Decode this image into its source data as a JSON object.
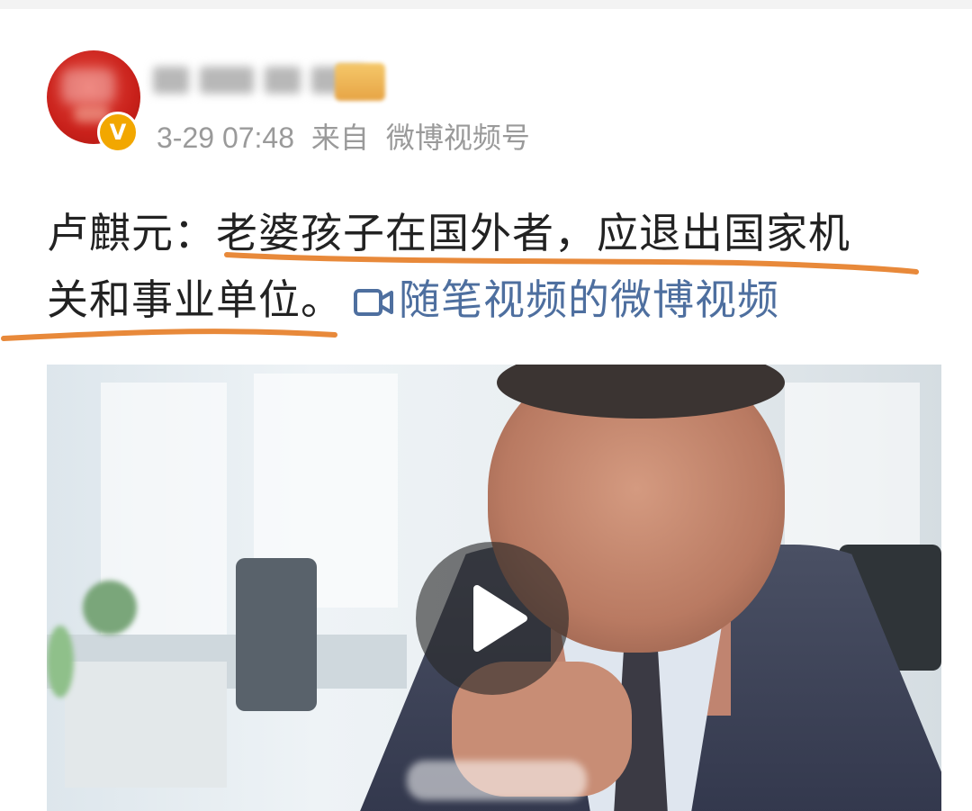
{
  "post": {
    "author": {
      "avatar_color": "#c9211b",
      "verified_badge_icon": "verified-v-icon",
      "badge_text": "V"
    },
    "meta": {
      "date": "3-29",
      "time": "07:48",
      "from_label": "来自",
      "source": "微博视频号"
    },
    "text": {
      "speaker": "卢麒元：",
      "line1_rest": "老婆孩子在国外者，应退出国家机",
      "line2": "关和事业单位。",
      "video_link_icon": "video-camera-icon",
      "video_link": "随笔视频的微博视频"
    },
    "annotations": {
      "underline_color": "#e8893a"
    },
    "video": {
      "play_icon": "play-icon"
    }
  },
  "colors": {
    "link": "#4e6f9f",
    "meta": "#9a9a9a",
    "text": "#222222"
  }
}
